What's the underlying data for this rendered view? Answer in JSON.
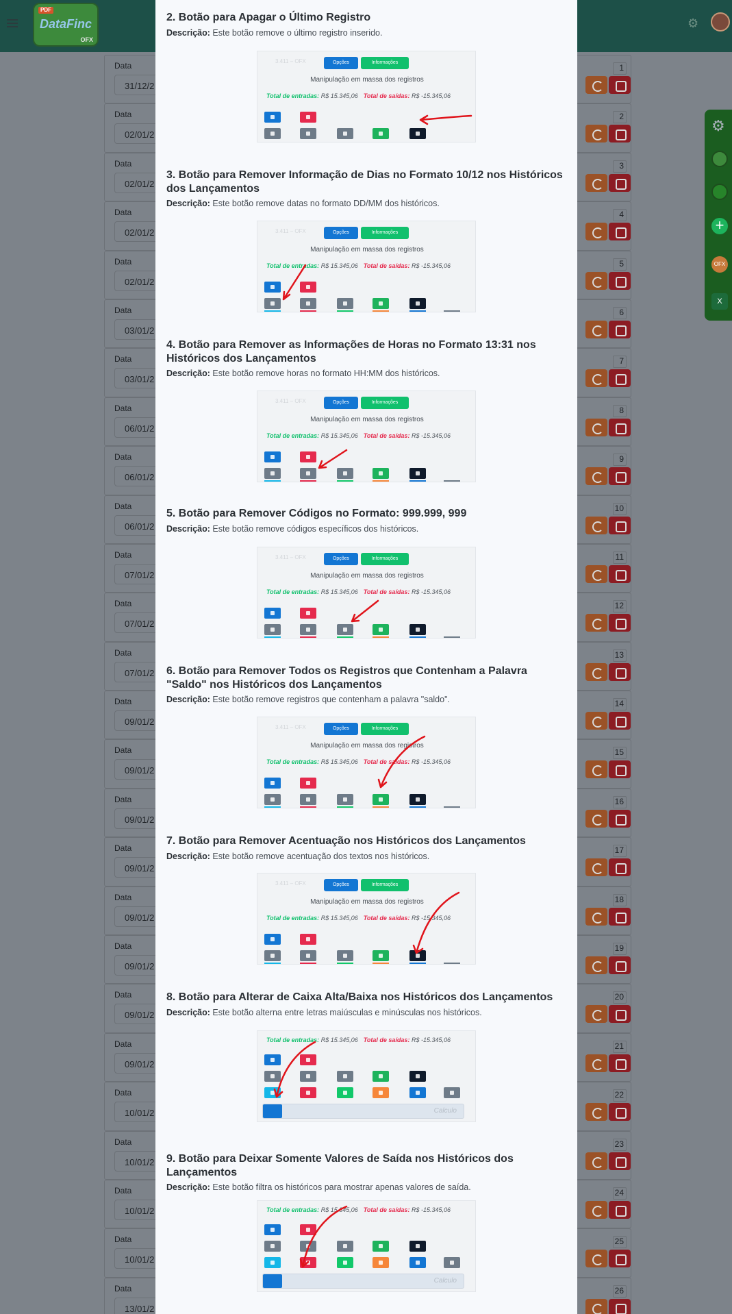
{
  "app": {
    "logo_text": "DataFinc",
    "logo_badge": "PDF",
    "logo_sub": "OFX",
    "field_label": "Data",
    "rows": [
      {
        "num": "1",
        "date": "31/12/2"
      },
      {
        "num": "2",
        "date": "02/01/2"
      },
      {
        "num": "3",
        "date": "02/01/2"
      },
      {
        "num": "4",
        "date": "02/01/2"
      },
      {
        "num": "5",
        "date": "02/01/2"
      },
      {
        "num": "6",
        "date": "03/01/2"
      },
      {
        "num": "7",
        "date": "03/01/2"
      },
      {
        "num": "8",
        "date": "06/01/2"
      },
      {
        "num": "9",
        "date": "06/01/2"
      },
      {
        "num": "10",
        "date": "06/01/2"
      },
      {
        "num": "11",
        "date": "07/01/2"
      },
      {
        "num": "12",
        "date": "07/01/2"
      },
      {
        "num": "13",
        "date": "07/01/2"
      },
      {
        "num": "14",
        "date": "09/01/2"
      },
      {
        "num": "15",
        "date": "09/01/2"
      },
      {
        "num": "16",
        "date": "09/01/2"
      },
      {
        "num": "17",
        "date": "09/01/2"
      },
      {
        "num": "18",
        "date": "09/01/2"
      },
      {
        "num": "19",
        "date": "09/01/2"
      },
      {
        "num": "20",
        "date": "09/01/2"
      },
      {
        "num": "21",
        "date": "09/01/2"
      },
      {
        "num": "22",
        "date": "10/01/2"
      },
      {
        "num": "23",
        "date": "10/01/2"
      },
      {
        "num": "24",
        "date": "10/01/2"
      },
      {
        "num": "25",
        "date": "10/01/2"
      },
      {
        "num": "26",
        "date": "13/01/2"
      }
    ]
  },
  "shot": {
    "tab_options": "Opções",
    "tab_info": "Informações",
    "mass_title": "Manipulação em massa dos registros",
    "in_label": "Total de entradas:",
    "in_value": "R$ 15.345,06",
    "out_label": "Total de saídas:",
    "out_value": "R$ -15.345,06",
    "calc_placeholder": "Calculo",
    "ghost": "3.411 – OFX"
  },
  "sections": [
    {
      "title": "2. Botão para Apagar o Último Registro",
      "label": "Descrição:",
      "desc": "Este botão remove o último registro inserido."
    },
    {
      "title": "3. Botão para Remover Informação de Dias no Formato 10/12 nos Históricos dos Lançamentos",
      "label": "Descrição:",
      "desc": "Este botão remove datas no formato DD/MM dos históricos."
    },
    {
      "title": "4. Botão para Remover as Informações de Horas no Formato 13:31 nos Históricos dos Lançamentos",
      "label": "Descrição:",
      "desc": "Este botão remove horas no formato HH:MM dos históricos."
    },
    {
      "title": "5. Botão para Remover Códigos no Formato: 999.999, 999",
      "label": "Descrição:",
      "desc": "Este botão remove códigos específicos dos históricos."
    },
    {
      "title": "6. Botão para Remover Todos os Registros que Contenham a Palavra \"Saldo\" nos Históricos dos Lançamentos",
      "label": "Descrição:",
      "desc": "Este botão remove registros que contenham a palavra \"saldo\"."
    },
    {
      "title": "7. Botão para Remover Acentuação nos Históricos dos Lançamentos",
      "label": "Descrição:",
      "desc": "Este botão remove acentuação dos textos nos históricos."
    },
    {
      "title": "8. Botão para Alterar de Caixa Alta/Baixa nos Históricos dos Lançamentos",
      "label": "Descrição:",
      "desc": "Este botão alterna entre letras maiúsculas e minúsculas nos históricos."
    },
    {
      "title": "9. Botão para Deixar Somente Valores de Saída nos Históricos dos Lançamentos",
      "label": "Descrição:",
      "desc": "Este botão filtra os históricos para mostrar apenas valores de saída."
    }
  ]
}
